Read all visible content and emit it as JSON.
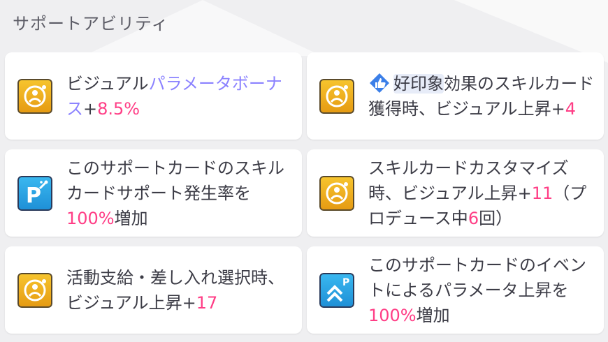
{
  "header": {
    "title": "サポートアビリティ"
  },
  "abilities": [
    {
      "icon": "visual-bonus-icon",
      "parts": [
        "ビジュアル",
        "パラメータボーナス",
        "+",
        "8.5%"
      ]
    },
    {
      "icon": "visual-bonus-icon",
      "parts": [
        "好印象",
        "効果のスキルカード獲得時、ビジュアル上昇+",
        "4"
      ]
    },
    {
      "icon": "support-p-icon",
      "parts": [
        "このサポートカードのスキルカードサポート発生率を",
        "100%",
        "増加"
      ]
    },
    {
      "icon": "visual-bonus-icon",
      "parts": [
        "スキルカードカスタマイズ時、ビジュアル上昇+",
        "11",
        "（プロデュース中",
        "6",
        "回）"
      ]
    },
    {
      "icon": "visual-bonus-icon",
      "parts": [
        "活動支給・差し入れ選択時、ビジュアル上昇+",
        "17"
      ]
    },
    {
      "icon": "event-param-up-icon",
      "parts": [
        "このサポートカードのイベントによるパラメータ上昇を",
        "100%",
        "増加"
      ]
    }
  ],
  "colors": {
    "highlight": "#ff3e86",
    "param_accent": "#8b82ff",
    "card_bg": "#ffffff",
    "page_bg": "#efeff1",
    "visual_icon_gold": "#f1b11c",
    "support_icon_blue": "#2aa6e8"
  }
}
